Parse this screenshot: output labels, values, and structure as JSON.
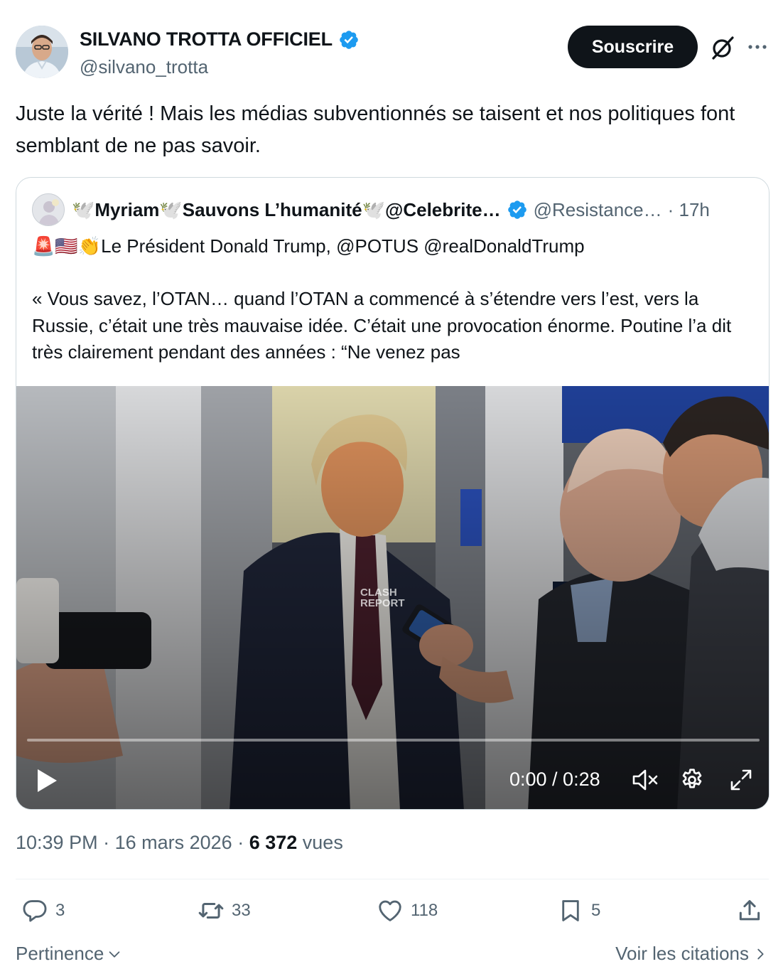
{
  "author": {
    "name": "SILVANO TROTTA OFFICIEL",
    "handle": "@silvano_trotta",
    "subscribe_label": "Souscrire"
  },
  "tweet": {
    "text": "Juste la vérité ! Mais les médias subventionnés se taisent et nos politiques font semblant de ne pas savoir."
  },
  "quote": {
    "name": "🕊️Myriam🕊️Sauvons L’humanité🕊️@Celebrite…",
    "handle": "@Resistance…",
    "time": "· 17h",
    "line1_emoji": "🚨🇺🇸👏",
    "line1_text": "Le Président Donald Trump, @POTUS @realDonaldTrump",
    "body": "« Vous savez, l’OTAN… quand l’OTAN a commencé à s’étendre vers l’est, vers la Russie, c’était une très mauvaise idée. C’était une provocation énorme. Poutine l’a dit très clairement pendant des années : “Ne venez pas",
    "video": {
      "time": "0:00 / 0:28",
      "progress": 0,
      "watermark_line1": "CLASH",
      "watermark_line2": "REPORT"
    }
  },
  "meta": {
    "time": "10:39 PM",
    "date": "16 mars 2026",
    "views": "6 372",
    "views_label": "vues",
    "separator": " · "
  },
  "actions": {
    "replies": "3",
    "retweets": "33",
    "likes": "118",
    "bookmarks": "5"
  },
  "footer": {
    "sort_label": "Pertinence",
    "quotes_link": "Voir les citations"
  },
  "colors": {
    "text": "#0f1419",
    "secondary": "#536471",
    "verified": "#1d9bf0",
    "border": "#cfd9de"
  }
}
